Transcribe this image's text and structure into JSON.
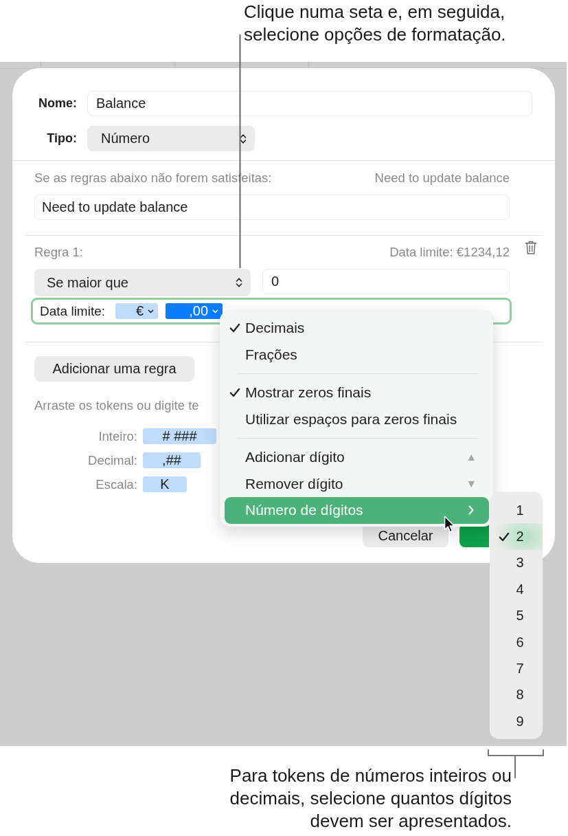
{
  "top_callout": {
    "text": "Clique numa seta e, em seguida, selecione opções de formatação."
  },
  "name_field": {
    "label": "Nome:",
    "value": "Balance"
  },
  "type_popup": {
    "label": "Tipo:",
    "value": "Número"
  },
  "failure_message": {
    "label": "Se as regras abaixo não forem satisfeitas:",
    "preview": "Need to update balance",
    "value": "Need to update balance"
  },
  "rules": [
    {
      "label": "Regra 1:",
      "preview": "Data limite: €1234,12",
      "condition": "Se maior que",
      "value": "0",
      "format": {
        "label": "Data limite:",
        "tokens": [
          {
            "text": "€",
            "selected": false
          },
          {
            "text": ",00",
            "selected": true
          }
        ]
      }
    }
  ],
  "add_rule_button": {
    "label": "Adicionar uma regra"
  },
  "hint": {
    "text": "Arraste os tokens ou digite te"
  },
  "token_rows": [
    {
      "label": "Inteiro:",
      "token": "# ###"
    },
    {
      "label": "Decimal:",
      "token": ",##"
    },
    {
      "label": "Escala:",
      "token": "K"
    }
  ],
  "buttons": [
    {
      "kind": "secondary",
      "label": "Cancelar"
    },
    {
      "kind": "primary"
    }
  ],
  "menu": {
    "items": [
      {
        "kind": "item",
        "label": "Decimais",
        "checked": true,
        "highlighted": false,
        "submenu": false
      },
      {
        "kind": "item",
        "label": "Frações",
        "checked": false,
        "highlighted": false,
        "submenu": false
      },
      {
        "kind": "separator"
      },
      {
        "kind": "item",
        "label": "Mostrar zeros finais",
        "checked": true,
        "highlighted": false,
        "submenu": false
      },
      {
        "kind": "item",
        "label": "Utilizar espaços para zeros finais",
        "checked": false,
        "highlighted": false,
        "submenu": false
      },
      {
        "kind": "separator"
      },
      {
        "kind": "item",
        "label": "Adicionar dígito",
        "key": "▲",
        "checked": false,
        "highlighted": false,
        "submenu": false
      },
      {
        "kind": "item",
        "label": "Remover dígito",
        "key": "▼",
        "checked": false,
        "highlighted": false,
        "submenu": false
      },
      {
        "kind": "item",
        "label": "Número de dígitos",
        "checked": false,
        "highlighted": true,
        "submenu": true
      }
    ]
  },
  "submenu": {
    "items": [
      {
        "label": "1",
        "checked": false,
        "highlighted": false
      },
      {
        "label": "2",
        "checked": true,
        "highlighted": true
      },
      {
        "label": "3",
        "checked": false,
        "highlighted": false
      },
      {
        "label": "4",
        "checked": false,
        "highlighted": false
      },
      {
        "label": "5",
        "checked": false,
        "highlighted": false
      },
      {
        "label": "6",
        "checked": false,
        "highlighted": false
      },
      {
        "label": "7",
        "checked": false,
        "highlighted": false
      },
      {
        "label": "8",
        "checked": false,
        "highlighted": false
      },
      {
        "label": "9",
        "checked": false,
        "highlighted": false
      }
    ]
  },
  "bottom_callout": {
    "text": "Para tokens de números inteiros ou decimais, selecione quantos dígitos devem ser apresentados."
  }
}
